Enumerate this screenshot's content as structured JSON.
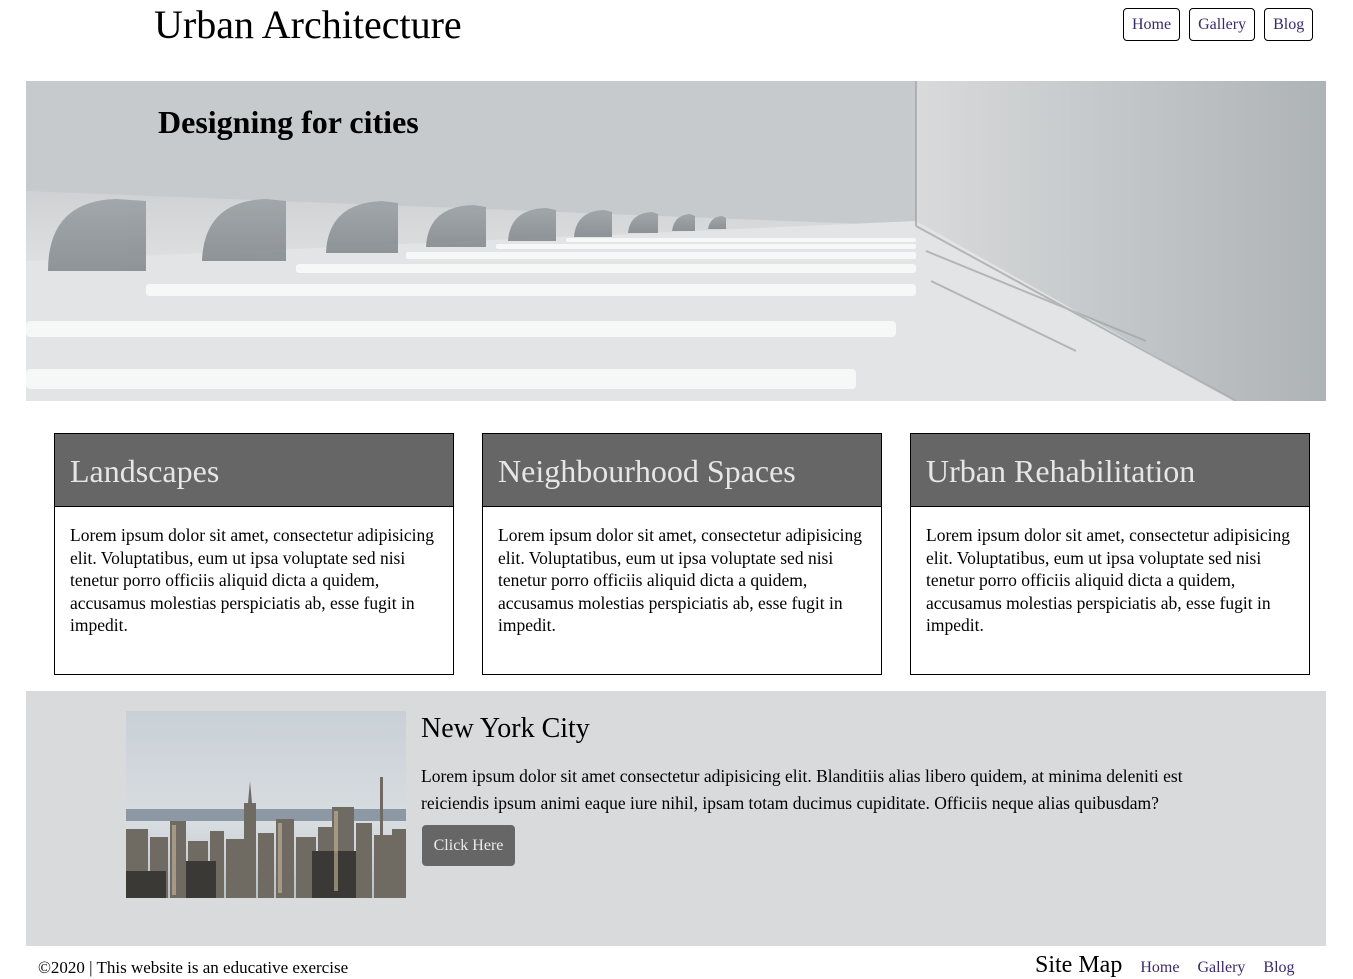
{
  "header": {
    "site_title": "Urban Architecture",
    "nav": [
      "Home",
      "Gallery",
      "Blog"
    ]
  },
  "hero": {
    "title": "Designing for cities"
  },
  "cards": [
    {
      "title": "Landscapes",
      "text": "Lorem ipsum dolor sit amet, consectetur adipisicing elit. Voluptatibus, eum ut ipsa voluptate sed nisi tenetur porro officiis aliquid dicta a quidem, accusamus molestias perspiciatis ab, esse fugit in impedit."
    },
    {
      "title": "Neighbourhood Spaces",
      "text": "Lorem ipsum dolor sit amet, consectetur adipisicing elit. Voluptatibus, eum ut ipsa voluptate sed nisi tenetur porro officiis aliquid dicta a quidem, accusamus molestias perspiciatis ab, esse fugit in impedit."
    },
    {
      "title": "Urban Rehabilitation",
      "text": "Lorem ipsum dolor sit amet, consectetur adipisicing elit. Voluptatibus, eum ut ipsa voluptate sed nisi tenetur porro officiis aliquid dicta a quidem, accusamus molestias perspiciatis ab, esse fugit in impedit."
    }
  ],
  "feature": {
    "title": "New York City",
    "text": "Lorem ipsum dolor sit amet consectetur adipisicing elit. Blanditiis alias libero quidem, at minima deleniti est reiciendis ipsum animi eaque iure nihil, ipsam totam ducimus cupiditate. Officiis neque alias quibusdam?",
    "button_label": "Click Here"
  },
  "footer": {
    "copyright": "©2020 | This website is an educative exercise",
    "sitemap_title": "Site Map",
    "sitemap_links": [
      "Home",
      "Gallery",
      "Blog"
    ]
  },
  "colors": {
    "card_header": "#666666",
    "feature_background": "#d9dadc",
    "link": "#3a2a6a"
  }
}
